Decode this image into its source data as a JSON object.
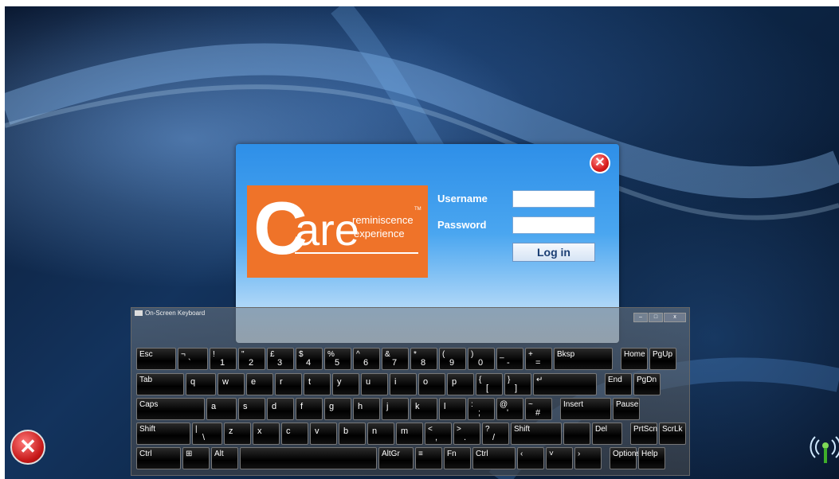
{
  "dialog": {
    "close_icon": "close-icon",
    "logo": {
      "big": "C",
      "word": "are",
      "line1": "reminiscence",
      "line2": "experience",
      "tm": "TM"
    },
    "username_label": "Username",
    "password_label": "Password",
    "username_value": "",
    "password_value": "",
    "login_label": "Log in",
    "colors": {
      "dialog_top": "#2e8fe8",
      "logo_bg": "#ef7329"
    }
  },
  "keyboard": {
    "title": "On-Screen Keyboard",
    "window_controls": {
      "minimize": "–",
      "maximize": "□",
      "close": "x"
    },
    "rows": [
      [
        {
          "t": "Esc"
        },
        {
          "t": "¬",
          "b": "`"
        },
        {
          "t": "!",
          "b": "1"
        },
        {
          "t": "\"",
          "b": "2"
        },
        {
          "t": "£",
          "b": "3"
        },
        {
          "t": "$",
          "b": "4"
        },
        {
          "t": "%",
          "b": "5"
        },
        {
          "t": "^",
          "b": "6"
        },
        {
          "t": "&",
          "b": "7"
        },
        {
          "t": "*",
          "b": "8"
        },
        {
          "t": "(",
          "b": "9"
        },
        {
          "t": ")",
          "b": "0"
        },
        {
          "t": "_",
          "b": "-"
        },
        {
          "t": "+",
          "b": "="
        },
        {
          "t": "Bksp"
        },
        {
          "t": "Home"
        },
        {
          "t": "PgUp"
        }
      ],
      [
        {
          "t": "Tab"
        },
        {
          "c": "q"
        },
        {
          "c": "w"
        },
        {
          "c": "e"
        },
        {
          "c": "r"
        },
        {
          "c": "t"
        },
        {
          "c": "y"
        },
        {
          "c": "u"
        },
        {
          "c": "i"
        },
        {
          "c": "o"
        },
        {
          "c": "p"
        },
        {
          "t": "{",
          "b": "["
        },
        {
          "t": "}",
          "b": "]"
        },
        {
          "t": "↵"
        },
        {
          "t": "End"
        },
        {
          "t": "PgDn"
        }
      ],
      [
        {
          "t": "Caps"
        },
        {
          "c": "a"
        },
        {
          "c": "s"
        },
        {
          "c": "d"
        },
        {
          "c": "f"
        },
        {
          "c": "g"
        },
        {
          "c": "h"
        },
        {
          "c": "j"
        },
        {
          "c": "k"
        },
        {
          "c": "l"
        },
        {
          "t": ":",
          "b": ";"
        },
        {
          "t": "@",
          "b": "'"
        },
        {
          "t": "~",
          "b": "#"
        },
        {
          "t": "Insert"
        },
        {
          "t": "Pause"
        }
      ],
      [
        {
          "t": "Shift"
        },
        {
          "t": "|",
          "b": "\\"
        },
        {
          "c": "z"
        },
        {
          "c": "x"
        },
        {
          "c": "c"
        },
        {
          "c": "v"
        },
        {
          "c": "b"
        },
        {
          "c": "n"
        },
        {
          "c": "m"
        },
        {
          "t": "<",
          "b": ","
        },
        {
          "t": ">",
          "b": "."
        },
        {
          "t": "?",
          "b": "/"
        },
        {
          "t": "Shift"
        },
        {
          "t": ""
        },
        {
          "t": "Del"
        },
        {
          "t": "PrtScn"
        },
        {
          "t": "ScrLk"
        }
      ],
      [
        {
          "t": "Ctrl"
        },
        {
          "t": "⊞"
        },
        {
          "t": "Alt"
        },
        {
          "t": ""
        },
        {
          "t": "AltGr"
        },
        {
          "t": "≡"
        },
        {
          "t": "Fn"
        },
        {
          "t": "Ctrl"
        },
        {
          "t": "‹"
        },
        {
          "t": "˅"
        },
        {
          "t": "›"
        },
        {
          "t": "Options"
        },
        {
          "t": "Help"
        }
      ]
    ]
  },
  "desktop": {
    "exit_icon": "exit-icon",
    "signal_icon": "signal-icon"
  }
}
